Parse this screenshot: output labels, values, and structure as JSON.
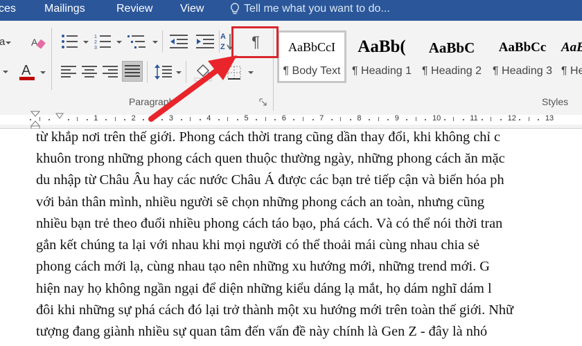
{
  "menu": {
    "tabs": [
      "ces",
      "Mailings",
      "Review",
      "View"
    ],
    "tell_me": "Tell me what you want to do..."
  },
  "ribbon": {
    "paragraph_group_label": "Paragraph",
    "styles_group_label": "Styles",
    "styles": [
      {
        "sample": "AaBbCcI",
        "name": "¶ Body Text",
        "selected": true
      },
      {
        "sample": "AaBb(",
        "name": "¶ Heading 1"
      },
      {
        "sample": "AaBbC",
        "name": "¶ Heading 2"
      },
      {
        "sample": "AaBbCc",
        "name": "¶ Heading 3"
      },
      {
        "sample": "AaB",
        "name": "¶ He"
      }
    ],
    "show_hide_glyph": "¶",
    "left_partial": "a",
    "sort_label": "A↓Z"
  },
  "colors": {
    "menubar": "#2b579a",
    "ribbon": "#f3f3f3",
    "font_color": "#c00000",
    "highlight_box": "#d9262c",
    "arrow": "#e8252b"
  },
  "ruler": {
    "labels": [
      "1",
      "2",
      "3",
      "4",
      "5",
      "6",
      "7",
      "8",
      "9",
      "10",
      "11",
      "12",
      "13"
    ]
  },
  "document": {
    "lines": [
      "từ khắp nơi trên thế giới. Phong cách thời trang cũng dần thay đổi, khi không chỉ c",
      "khuôn trong những phong cách quen thuộc thường ngày, những phong cách ăn mặc",
      "du nhập từ Châu Âu hay các nước Châu Á được các bạn trẻ tiếp cận và biến hóa ph",
      "với bản thân mình, nhiều người sẽ chọn những phong cách an toàn, nhưng cũng",
      "nhiều bạn trẻ theo đuổi nhiều phong cách táo bạo, phá cách. Và có thể nói thời tran",
      "gắn kết chúng ta lại với nhau khi mọi người có thể thoải mái cùng nhau chia sẻ",
      "phong cách mới lạ, cùng nhau tạo nên những xu hướng mới, những trend mới. G",
      "hiện nay họ không ngần ngại để diện những kiểu dáng lạ mắt, họ dám nghĩ dám l",
      "đôi khi những sự phá cách đó lại trở thành một xu hướng mới trên toàn thế giới. Nhữ",
      "tượng đang giành nhiều sự quan tâm đến vấn đề này chính là Gen Z - đây là nhó"
    ]
  }
}
